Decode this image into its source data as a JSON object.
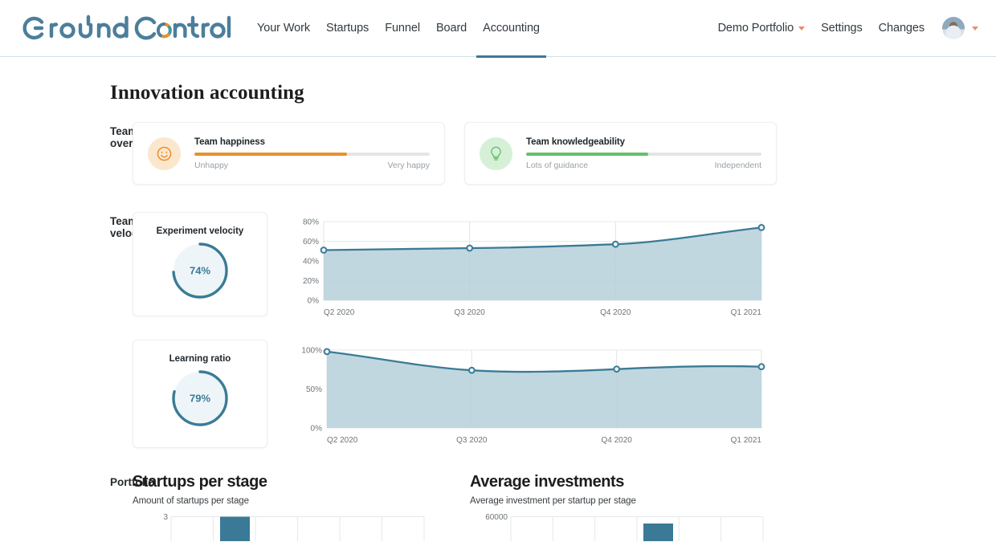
{
  "brand": {
    "logo_text": "GroundControl",
    "logo_color": "#4b7e9b",
    "accent_teal": "#3b7b96",
    "accent_orange": "#e8902e",
    "accent_green": "#62c16a"
  },
  "nav": {
    "left_items": [
      {
        "label": "Your Work",
        "active": false
      },
      {
        "label": "Startups",
        "active": false
      },
      {
        "label": "Funnel",
        "active": false
      },
      {
        "label": "Board",
        "active": false
      },
      {
        "label": "Accounting",
        "active": true
      }
    ],
    "right_items": [
      {
        "label": "Demo Portfolio",
        "caret": true
      },
      {
        "label": "Settings",
        "caret": false
      },
      {
        "label": "Changes",
        "caret": false
      }
    ]
  },
  "page": {
    "title": "Innovation accounting"
  },
  "sections": {
    "team_overview": {
      "label": "Team overview",
      "cards": [
        {
          "icon": "smiley-icon",
          "title": "Team happiness",
          "percent": 65,
          "color": "#e8902e",
          "icon_bg": "#fbe7cd",
          "left_label": "Unhappy",
          "right_label": "Very happy"
        },
        {
          "icon": "lightbulb-icon",
          "title": "Team knowledgeability",
          "percent": 52,
          "color": "#62c16a",
          "icon_bg": "#d6f0d7",
          "left_label": "Lots of guidance",
          "right_label": "Independent"
        }
      ]
    },
    "team_velocity": {
      "label": "Team velocity",
      "donuts": [
        {
          "title": "Experiment velocity",
          "value": "74%",
          "percent": 74
        },
        {
          "title": "Learning ratio",
          "value": "79%",
          "percent": 79
        }
      ]
    },
    "portfolio": {
      "label": "Portfolio",
      "charts": [
        {
          "title": "Startups per stage",
          "subtitle": "Amount of startups per stage"
        },
        {
          "title": "Average investments",
          "subtitle": "Average investment per startup per stage"
        }
      ]
    }
  },
  "chart_data": [
    {
      "type": "area",
      "title": "Experiment velocity",
      "x": [
        "Q2 2020",
        "Q3 2020",
        "Q4 2020",
        "Q1 2021"
      ],
      "values": [
        51,
        53,
        57,
        74
      ],
      "ylabel": "",
      "xlabel": "",
      "ylim": [
        0,
        80
      ],
      "yticks": [
        0,
        20,
        40,
        60,
        80
      ],
      "ytick_labels": [
        "0%",
        "20%",
        "40%",
        "60%",
        "80%"
      ],
      "grid": true,
      "line_color": "#3b7b96",
      "fill_color": "#b6d0d9"
    },
    {
      "type": "area",
      "title": "Learning ratio",
      "x": [
        "Q2 2020",
        "Q3 2020",
        "Q4 2020",
        "Q1 2021"
      ],
      "values": [
        98,
        74,
        76,
        79
      ],
      "ylabel": "",
      "xlabel": "",
      "ylim": [
        0,
        100
      ],
      "yticks": [
        0,
        50,
        100
      ],
      "ytick_labels": [
        "0%",
        "50%",
        "100%"
      ],
      "grid": true,
      "line_color": "#3b7b96",
      "fill_color": "#b6d0d9"
    },
    {
      "type": "bar",
      "title": "Startups per stage",
      "subtitle": "Amount of startups per stage",
      "categories": [
        "",
        "",
        "",
        "",
        "",
        ""
      ],
      "values": [
        0,
        3,
        0,
        0,
        0,
        0
      ],
      "ylim": [
        0,
        3
      ],
      "ytick_labels": [
        "3"
      ],
      "bar_color": "#3a7a96",
      "grid": true
    },
    {
      "type": "bar",
      "title": "Average investments",
      "subtitle": "Average investment per startup per stage",
      "categories": [
        "",
        "",
        "",
        "",
        "",
        ""
      ],
      "values": [
        0,
        0,
        0,
        42000,
        0,
        0
      ],
      "ylim": [
        0,
        60000
      ],
      "ytick_labels": [
        "60000"
      ],
      "bar_color": "#3a7a96",
      "grid": true
    }
  ]
}
